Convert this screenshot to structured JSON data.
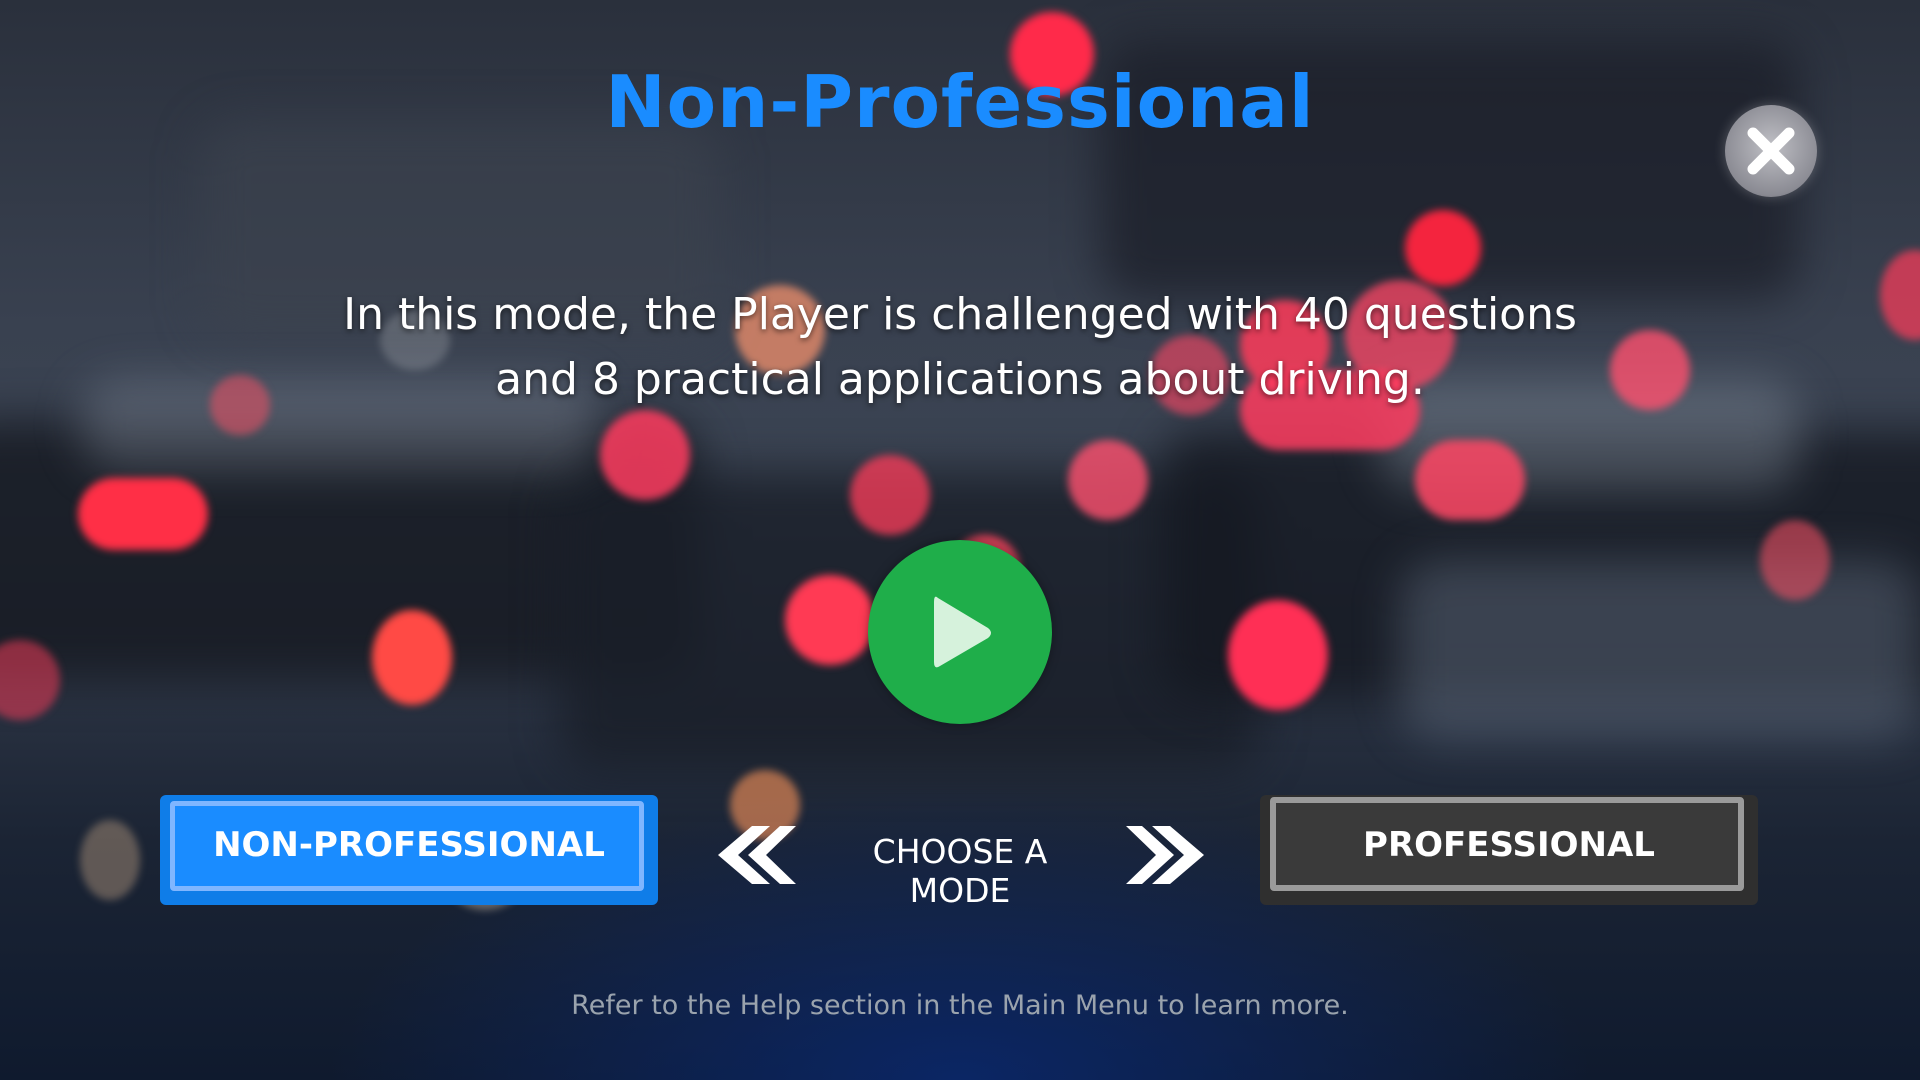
{
  "screen": {
    "title": "Non-Professional",
    "description_line1": "In this mode, the Player is challenged with 40 questions",
    "description_line2": "and 8 practical applications about driving.",
    "help_text": "Refer to the Help section in the Main Menu to learn more."
  },
  "mode_selector": {
    "left_mode_label": "NON-PROFESSIONAL",
    "center_label": "CHOOSE A MODE",
    "right_mode_label": "PROFESSIONAL",
    "selected": "NON-PROFESSIONAL"
  },
  "icons": {
    "close": "close-icon",
    "play": "play-icon",
    "prev": "double-chevron-left-icon",
    "next": "double-chevron-right-icon"
  },
  "colors": {
    "accent": "#1a8cff",
    "play": "#1fae4a",
    "inactive_button": "#3a3a3a",
    "help_text": "#9aa3ad"
  }
}
